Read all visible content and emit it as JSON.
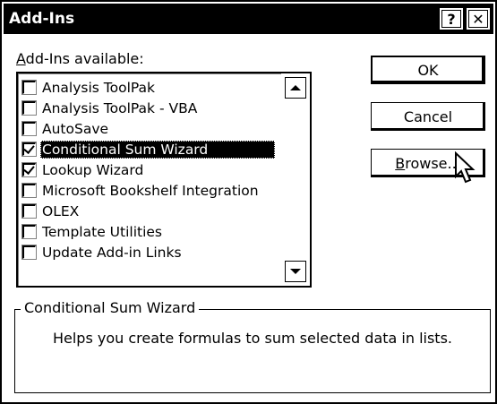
{
  "window": {
    "title": "Add-Ins",
    "help_label": "?",
    "close_label": "✕"
  },
  "list": {
    "label": "Add-Ins available:",
    "label_access_key": "A",
    "label_rest": "dd-Ins available:",
    "items": [
      {
        "label": "Analysis ToolPak",
        "checked": false
      },
      {
        "label": "Analysis ToolPak - VBA",
        "checked": false
      },
      {
        "label": "AutoSave",
        "checked": false
      },
      {
        "label": "Conditional Sum Wizard",
        "checked": true,
        "selected": true
      },
      {
        "label": "Lookup Wizard",
        "checked": true
      },
      {
        "label": "Microsoft Bookshelf Integration",
        "checked": false
      },
      {
        "label": "OLEX",
        "checked": false
      },
      {
        "label": "Template Utilities",
        "checked": false
      },
      {
        "label": "Update Add-in Links",
        "checked": false
      }
    ]
  },
  "buttons": {
    "ok": "OK",
    "cancel": "Cancel",
    "browse_access_key": "B",
    "browse_rest": "rowse..."
  },
  "description": {
    "title": "Conditional Sum Wizard",
    "text": "Helps you create formulas to sum selected data in lists."
  },
  "icons": {
    "cursor": "arrow-cursor-icon",
    "scroll_up": "scroll-up-arrow-icon",
    "scroll_down": "scroll-down-arrow-icon",
    "check": "checkmark-icon"
  },
  "colors": {
    "titlebar": "#000000",
    "selection": "#000000",
    "background": "#ffffff"
  }
}
